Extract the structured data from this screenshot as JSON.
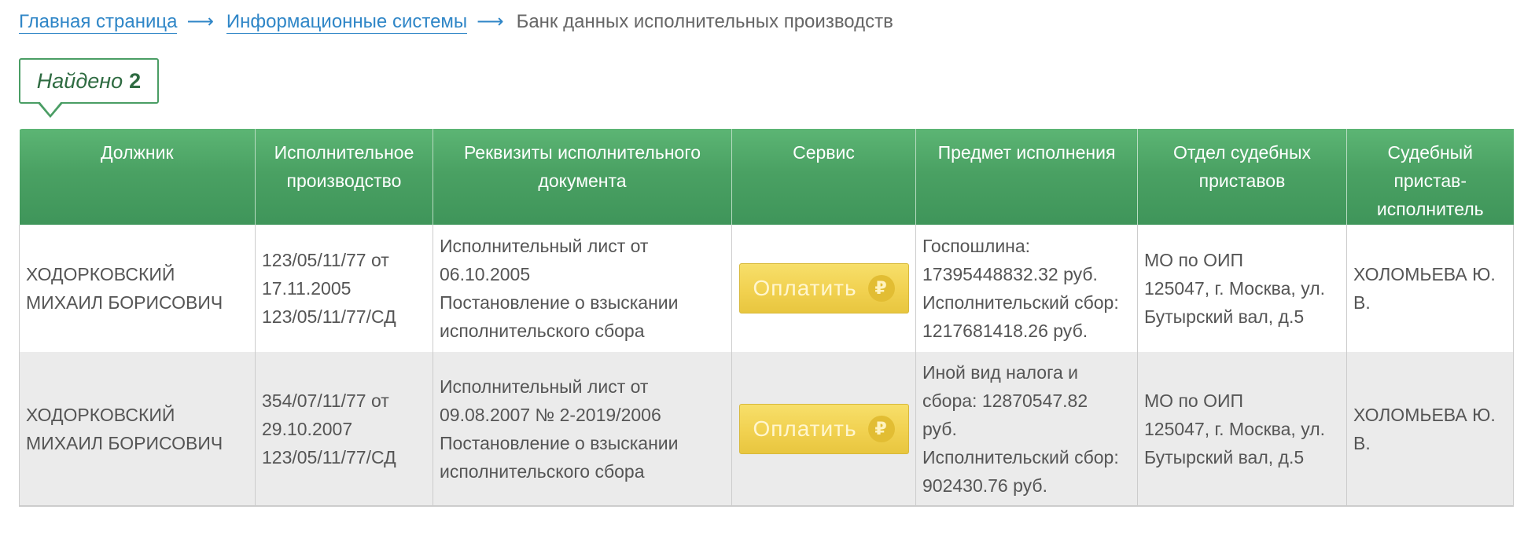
{
  "breadcrumb": {
    "items": [
      {
        "label": "Главная страница"
      },
      {
        "label": "Информационные системы"
      }
    ],
    "separator": "⟶",
    "current": "Банк данных исполнительных производств"
  },
  "found": {
    "label": "Найдено",
    "count": "2"
  },
  "table": {
    "headers": [
      "Должник",
      "Исполнительное производство",
      "Реквизиты исполнительного документа",
      "Сервис",
      "Предмет исполнения",
      "Отдел судебных приставов",
      "Судебный пристав-исполнитель"
    ],
    "rows": [
      {
        "debtor": [
          "ХОДОРКОВСКИЙ",
          "МИХАИЛ БОРИСОВИЧ"
        ],
        "proceeding": [
          "123/05/11/77 от",
          "17.11.2005",
          "123/05/11/77/СД"
        ],
        "document": [
          "Исполнительный лист от",
          "06.10.2005",
          "Постановление о взыскании",
          "исполнительского сбора"
        ],
        "service_label": "Оплатить",
        "subject": [
          "Госпошлина:",
          "17395448832.32 руб.",
          "Исполнительский сбор:",
          "1217681418.26 руб."
        ],
        "department": [
          "МО по ОИП",
          "125047, г. Москва, ул.",
          "Бутырский вал, д.5"
        ],
        "bailiff": [
          "ХОЛОМЬЕВА Ю.",
          "В."
        ]
      },
      {
        "debtor": [
          "ХОДОРКОВСКИЙ",
          "МИХАИЛ БОРИСОВИЧ"
        ],
        "proceeding": [
          "354/07/11/77 от",
          "29.10.2007",
          "123/05/11/77/СД"
        ],
        "document": [
          "Исполнительный лист от",
          "09.08.2007 № 2-2019/2006",
          "Постановление о взыскании",
          "исполнительского сбора"
        ],
        "service_label": "Оплатить",
        "subject": [
          "Иной вид налога и",
          "сбора: 12870547.82",
          "руб.",
          "Исполнительский сбор:",
          "902430.76 руб."
        ],
        "department": [
          "МО по ОИП",
          "125047, г. Москва, ул.",
          "Бутырский вал, д.5"
        ],
        "bailiff": [
          "ХОЛОМЬЕВА Ю.",
          "В."
        ]
      }
    ]
  },
  "colors": {
    "header_green": "#4aa163",
    "link_blue": "#2f86c7",
    "pay_yellow": "#f1d150",
    "alt_row": "#ebebeb"
  },
  "icons": {
    "pay": "ruble-icon",
    "breadcrumb_separator": "arrow-right-icon"
  }
}
